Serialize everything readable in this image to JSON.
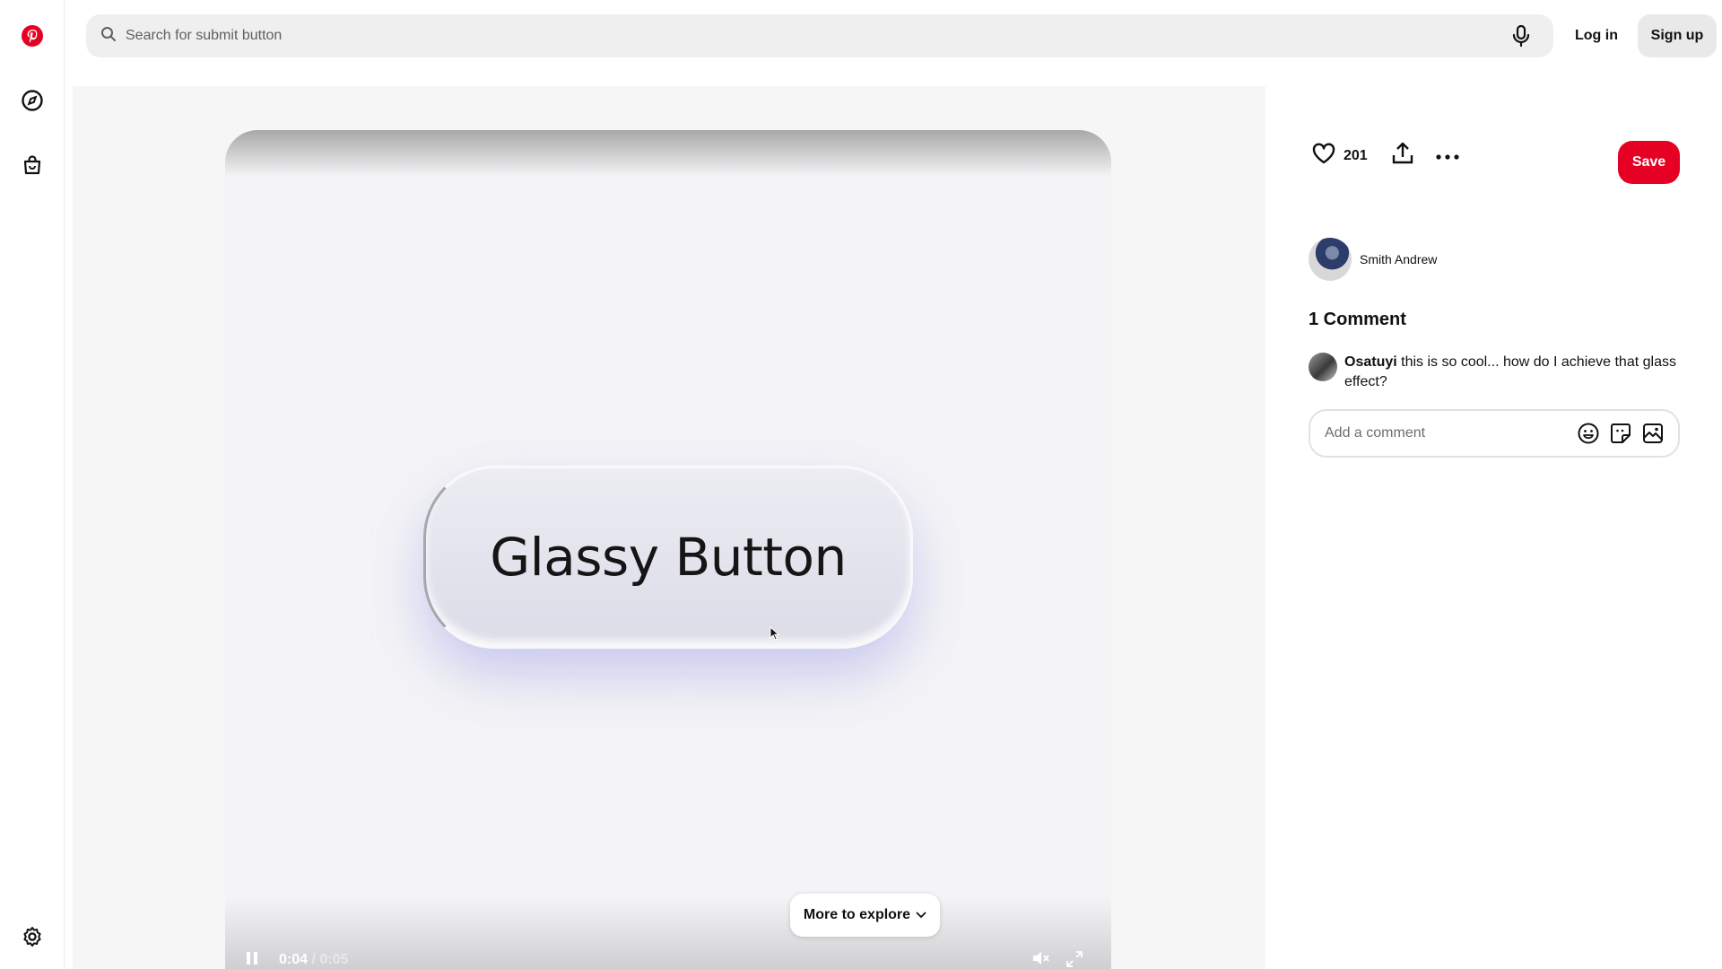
{
  "header": {
    "search_placeholder": "Search for submit button",
    "login_label": "Log in",
    "signup_label": "Sign up"
  },
  "sidebar": {
    "items": [
      {
        "name": "pinterest-logo-icon"
      },
      {
        "name": "explore-compass-icon"
      },
      {
        "name": "shop-bag-icon"
      },
      {
        "name": "settings-gear-icon"
      }
    ]
  },
  "video": {
    "button_text": "Glassy Button",
    "current_time": "0:04",
    "duration": "/ 0:05",
    "more_label": "More to explore"
  },
  "pin": {
    "like_count": "201",
    "save_label": "Save",
    "author_name": "Smith Andrew"
  },
  "comments": {
    "count_label": "1 Comment",
    "items": [
      {
        "user": "Osatuyi",
        "text": "this is so cool... how do I achieve that glass effect?"
      }
    ],
    "add_placeholder": "Add a comment"
  },
  "colors": {
    "brand": "#e60023",
    "pill_bg": "#e9e9e9"
  }
}
